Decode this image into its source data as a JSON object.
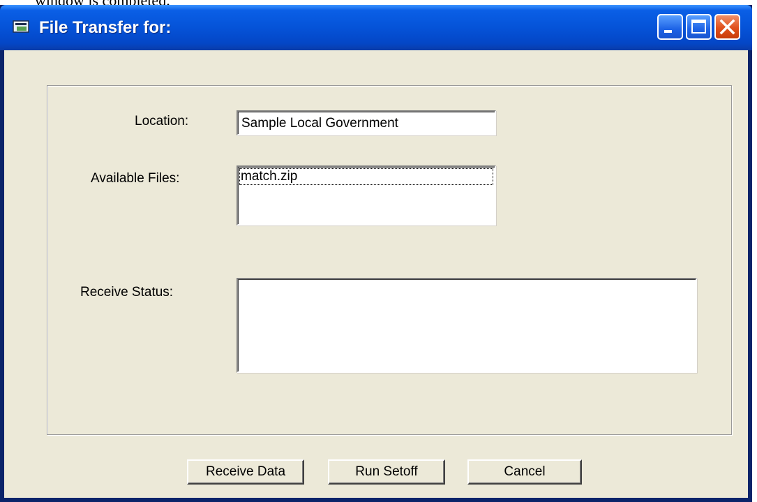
{
  "background": {
    "text": "window is completed."
  },
  "window": {
    "title": "File Transfer for:",
    "controls": {
      "minimize": "minimize-icon",
      "maximize": "maximize-icon",
      "close": "close-icon"
    }
  },
  "form": {
    "location_label": "Location:",
    "location_value": "Sample Local Government",
    "available_files_label": "Available Files:",
    "available_files": [
      "match.zip"
    ],
    "receive_status_label": "Receive Status:",
    "receive_status_value": ""
  },
  "buttons": {
    "receive": "Receive Data",
    "run_setoff": "Run Setoff",
    "cancel": "Cancel"
  },
  "colors": {
    "titlebar": "#0553d8",
    "client": "#ece9d8",
    "close": "#e0501c"
  }
}
